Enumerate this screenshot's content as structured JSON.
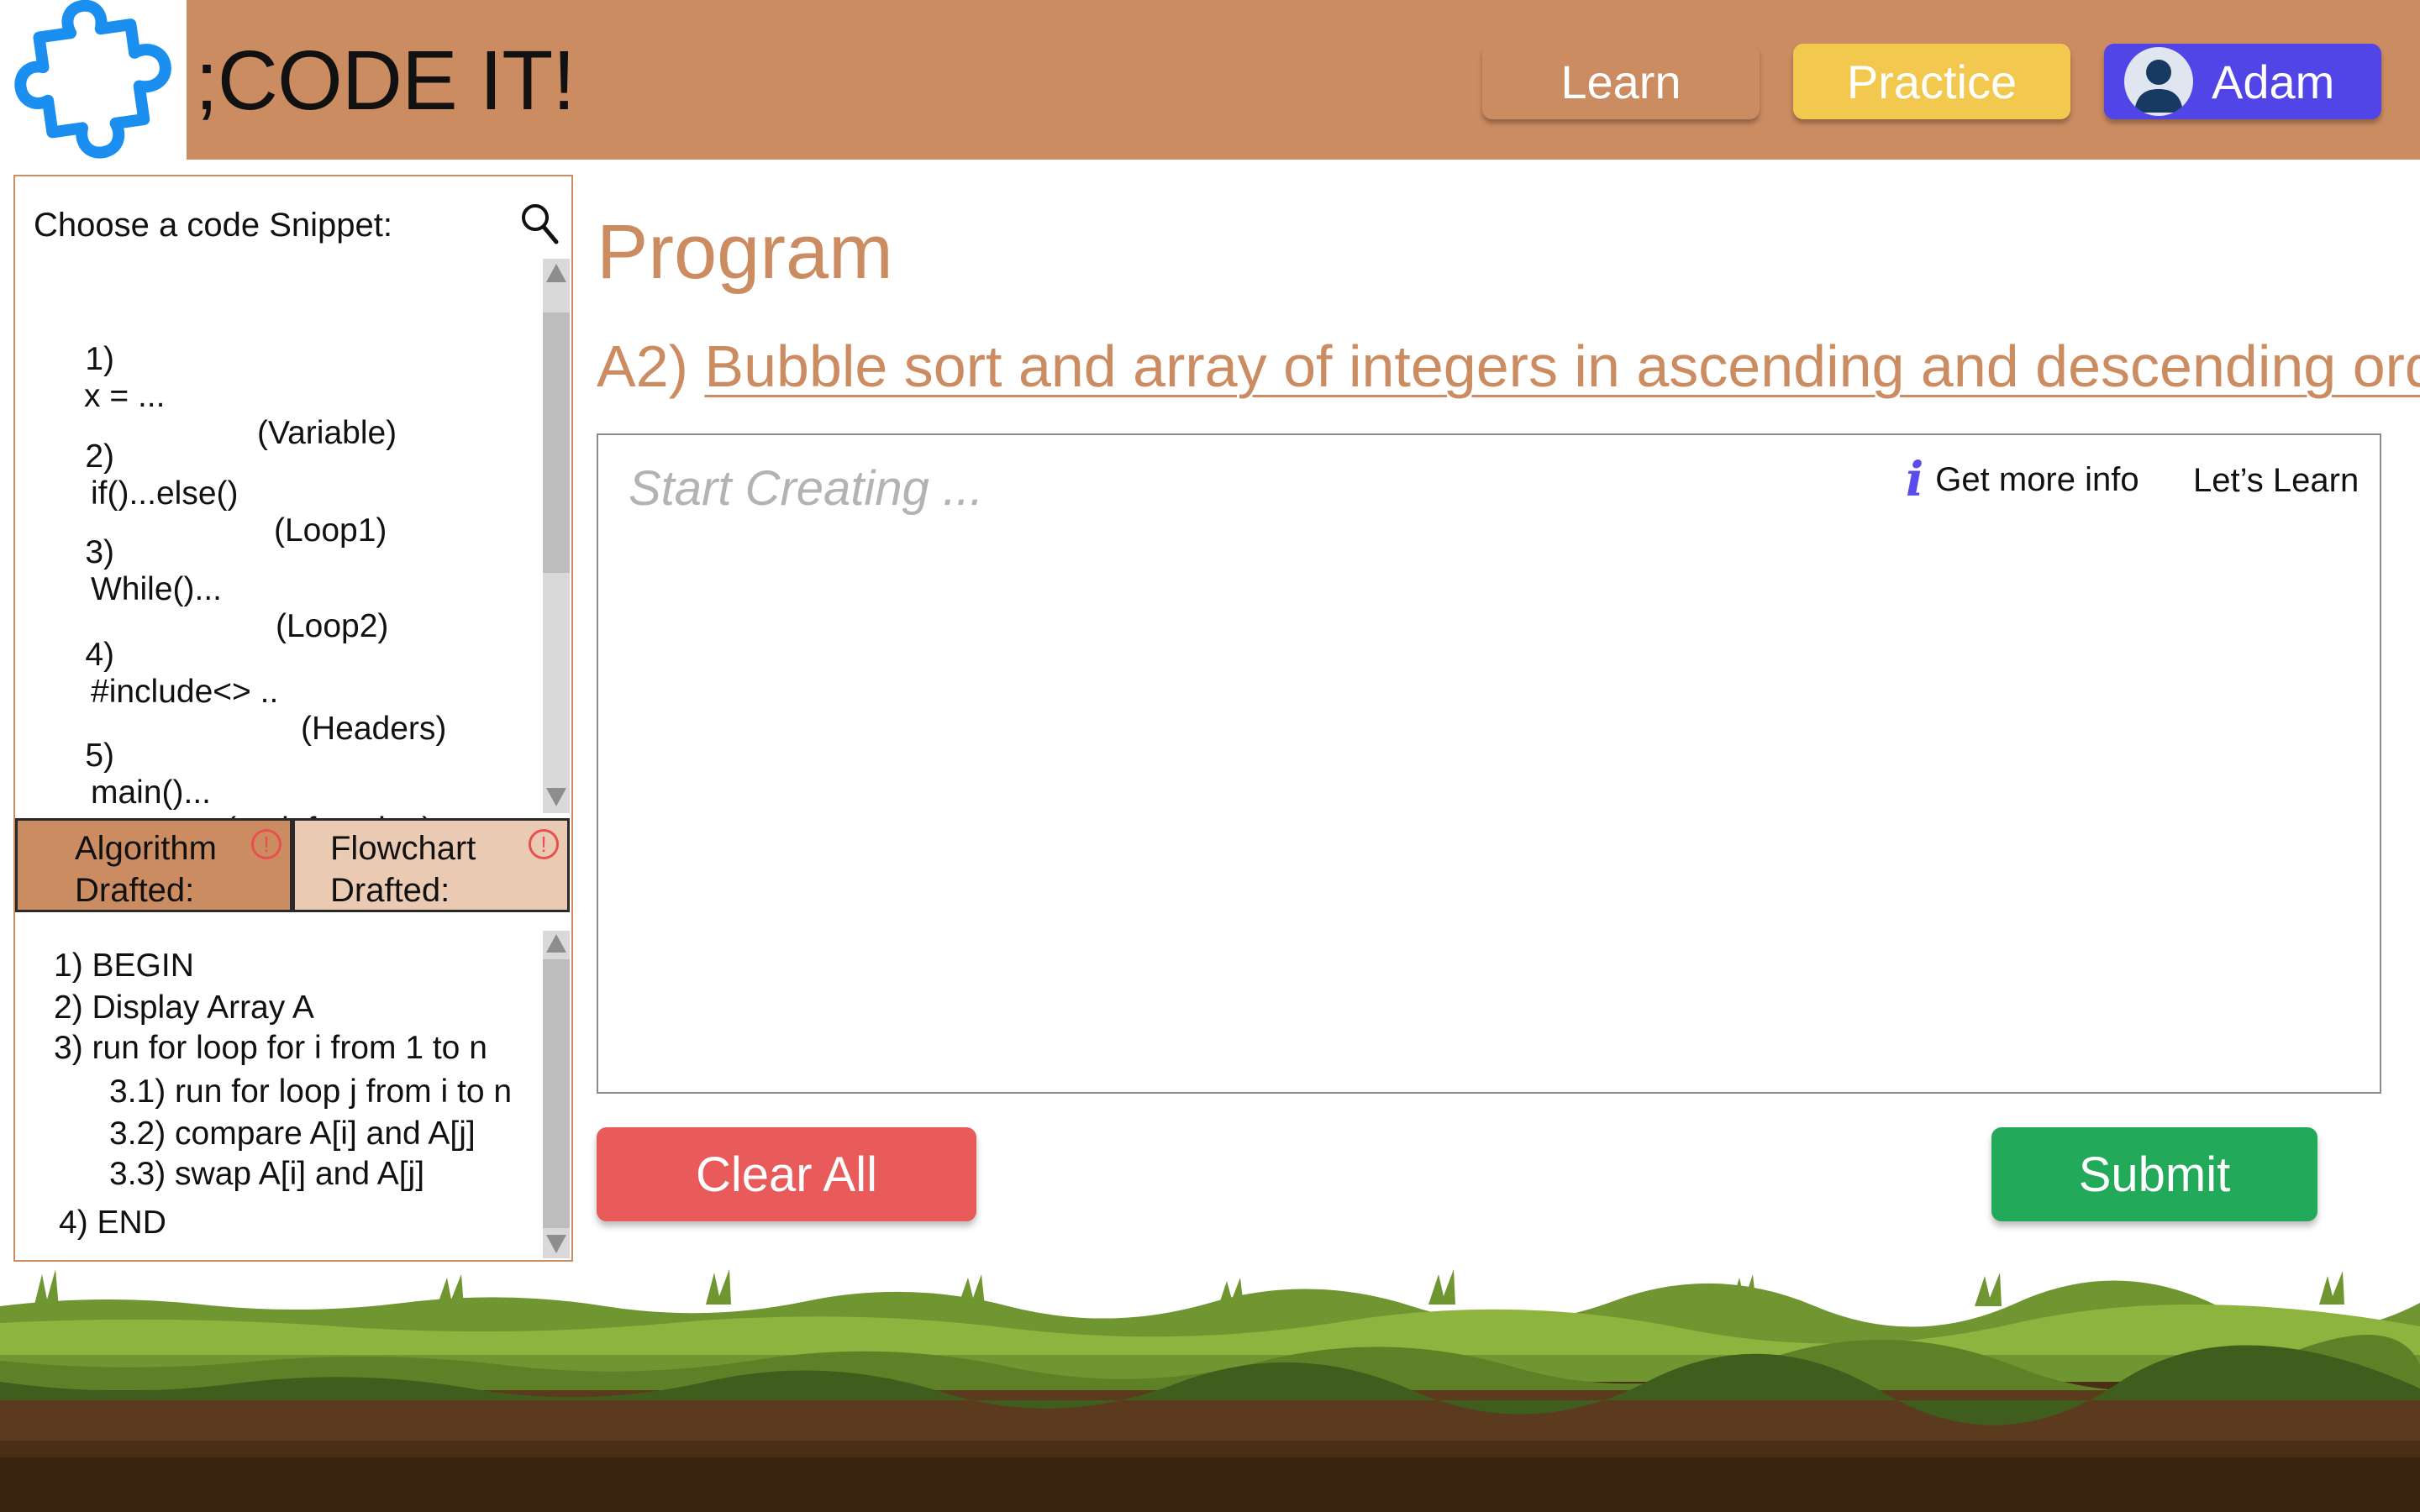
{
  "app": {
    "brand": ";CODE IT!"
  },
  "nav": {
    "learn": "Learn",
    "practice": "Practice",
    "user": "Adam"
  },
  "snippets": {
    "title": "Choose a code Snippet:",
    "items": [
      {
        "num": "1)",
        "code": "x = ...",
        "tag": "(Variable)"
      },
      {
        "num": "2)",
        "code": "if()...else()",
        "tag": "(Loop1)"
      },
      {
        "num": "3)",
        "code": "While()...",
        "tag": "(Loop2)"
      },
      {
        "num": "4)",
        "code": "#include<> ..",
        "tag": "(Headers)"
      },
      {
        "num": "5)",
        "code": "main()...",
        "tag": "(mainfunction)"
      }
    ]
  },
  "tabs": {
    "algorithm": {
      "line1": "Algorithm",
      "line2": "Drafted:",
      "warn": "!"
    },
    "flowchart": {
      "line1": "Flowchart",
      "line2": "Drafted:",
      "warn": "!"
    }
  },
  "algorithm": [
    "1) BEGIN",
    "2) Display Array A",
    "3) run for loop for i from 1 to n",
    "3.1) run for loop j from i to n",
    "3.2) compare A[i] and A[j]",
    "3.3) swap A[i] and A[j]",
    "4) END"
  ],
  "main": {
    "title": "Program",
    "task_id": "A2)",
    "task_name": "Bubble sort and array of integers in ascending and descending order",
    "placeholder": "Start Creating ...",
    "info_icon": "i",
    "info_label": "Get more info",
    "learn_link": "Let’s Learn",
    "clear_label": "Clear All",
    "submit_label": "Submit"
  },
  "colors": {
    "brand": "#cc8c61",
    "practice": "#f2c84f",
    "user": "#5245e8",
    "clear": "#e95a5a",
    "submit": "#22aa5a",
    "logo": "#1a8ff0"
  }
}
